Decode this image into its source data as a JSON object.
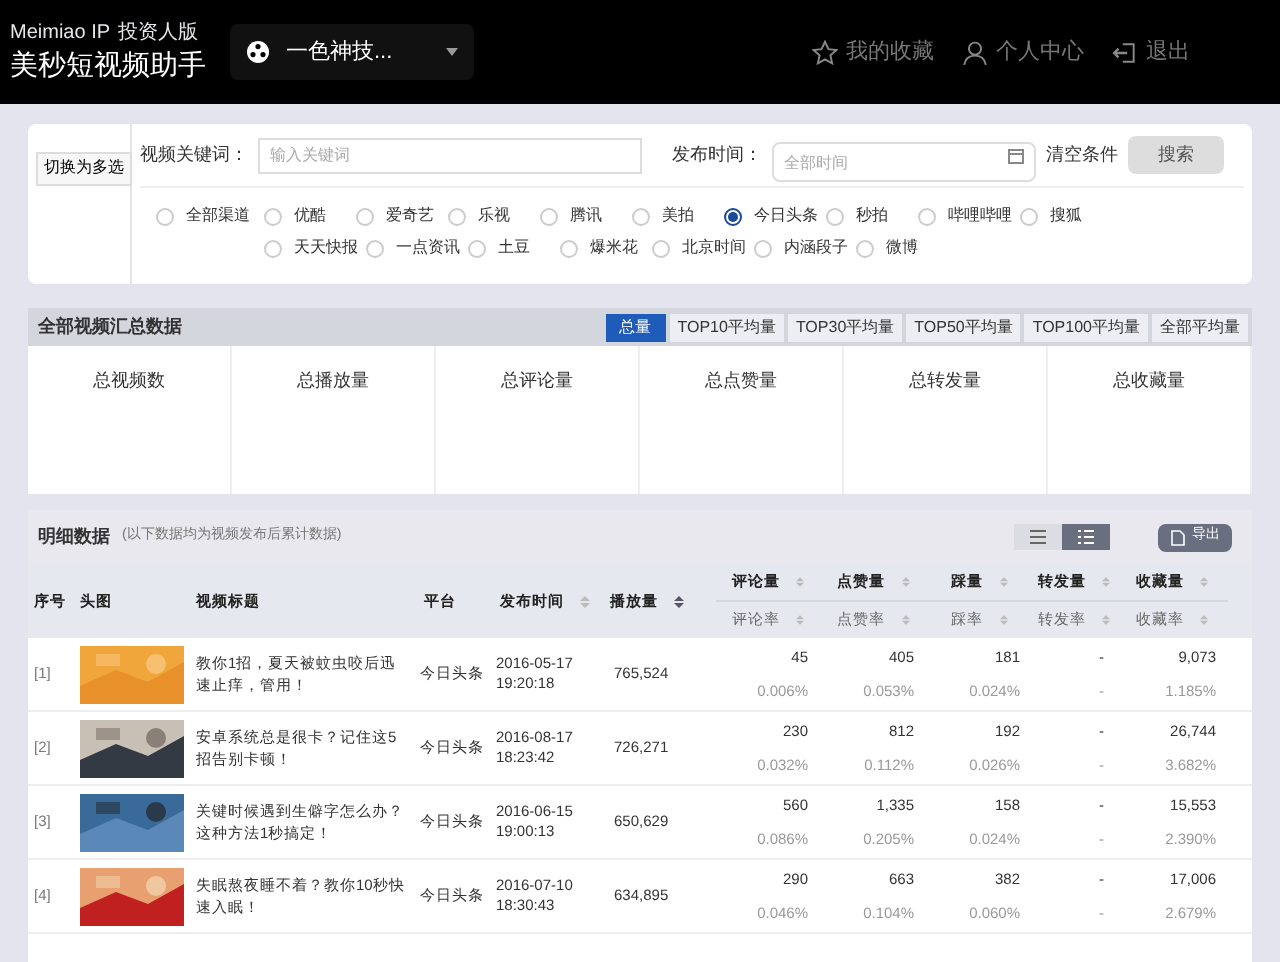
{
  "header": {
    "brand": "Meimiao IP",
    "edition": "投资人版",
    "app_name": "美秒短视频助手",
    "channel_select": "一色神技...",
    "nav": [
      {
        "kind": "favorites",
        "label": "我的收藏"
      },
      {
        "kind": "profile",
        "label": "个人中心"
      },
      {
        "kind": "logout",
        "label": "退出"
      }
    ]
  },
  "filters": {
    "multi_toggle": "切换为多选",
    "keyword_label": "视频关键词：",
    "keyword_placeholder": "输入关键词",
    "date_label": "发布时间：",
    "date_placeholder": "全部时间",
    "clear": "清空条件",
    "search": "搜索",
    "channels": [
      {
        "label": "全部渠道",
        "selected": false
      },
      {
        "label": "优酷",
        "selected": false
      },
      {
        "label": "爱奇艺",
        "selected": false
      },
      {
        "label": "乐视",
        "selected": false
      },
      {
        "label": "腾讯",
        "selected": false
      },
      {
        "label": "美拍",
        "selected": false
      },
      {
        "label": "今日头条",
        "selected": true
      },
      {
        "label": "秒拍",
        "selected": false
      },
      {
        "label": "哔哩哔哩",
        "selected": false
      },
      {
        "label": "搜狐",
        "selected": false
      },
      {
        "label": "天天快报",
        "selected": false
      },
      {
        "label": "一点资讯",
        "selected": false
      },
      {
        "label": "土豆",
        "selected": false
      },
      {
        "label": "爆米花",
        "selected": false
      },
      {
        "label": "北京时间",
        "selected": false
      },
      {
        "label": "内涵段子",
        "selected": false
      },
      {
        "label": "微博",
        "selected": false
      }
    ]
  },
  "summary": {
    "title": "全部视频汇总数据",
    "tabs": [
      {
        "label": "总量",
        "selected": true
      },
      {
        "label": "TOP10平均量",
        "selected": false
      },
      {
        "label": "TOP30平均量",
        "selected": false
      },
      {
        "label": "TOP50平均量",
        "selected": false
      },
      {
        "label": "TOP100平均量",
        "selected": false
      },
      {
        "label": "全部平均量",
        "selected": false
      }
    ],
    "stats": [
      {
        "label": "总视频数"
      },
      {
        "label": "总播放量"
      },
      {
        "label": "总评论量"
      },
      {
        "label": "总点赞量"
      },
      {
        "label": "总转发量"
      },
      {
        "label": "总收藏量"
      }
    ]
  },
  "detail": {
    "title": "明细数据",
    "note": "(以下数据均为视频发布后累计数据)",
    "view_toggle": [
      {
        "kind": "list",
        "selected": false
      },
      {
        "kind": "detail",
        "selected": true
      }
    ],
    "export": "导出",
    "columns": [
      "序号",
      "头图",
      "视频标题",
      "平台",
      "发布时间",
      "播放量"
    ],
    "metric_columns": [
      {
        "count": "评论量",
        "rate": "评论率"
      },
      {
        "count": "点赞量",
        "rate": "点赞率"
      },
      {
        "count": "踩量",
        "rate": "踩率"
      },
      {
        "count": "转发量",
        "rate": "转发率"
      },
      {
        "count": "收藏量",
        "rate": "收藏率"
      }
    ],
    "rows": [
      {
        "index": "[1]",
        "title": "教你1招，夏天被蚊虫咬后迅速止痒，管用！",
        "platform": "今日头条",
        "date": "2016-05-17",
        "time": "19:20:18",
        "plays": "765,524",
        "metrics": [
          {
            "count": "45",
            "rate": "0.006%"
          },
          {
            "count": "405",
            "rate": "0.053%"
          },
          {
            "count": "181",
            "rate": "0.024%"
          },
          {
            "count": "-",
            "rate": "-"
          },
          {
            "count": "9,073",
            "rate": "1.185%"
          }
        ]
      },
      {
        "index": "[2]",
        "title": "安卓系统总是很卡？记住这5招告别卡顿！",
        "platform": "今日头条",
        "date": "2016-08-17",
        "time": "18:23:42",
        "plays": "726,271",
        "metrics": [
          {
            "count": "230",
            "rate": "0.032%"
          },
          {
            "count": "812",
            "rate": "0.112%"
          },
          {
            "count": "192",
            "rate": "0.026%"
          },
          {
            "count": "-",
            "rate": "-"
          },
          {
            "count": "26,744",
            "rate": "3.682%"
          }
        ]
      },
      {
        "index": "[3]",
        "title": "关键时候遇到生僻字怎么办？这种方法1秒搞定！",
        "platform": "今日头条",
        "date": "2016-06-15",
        "time": "19:00:13",
        "plays": "650,629",
        "metrics": [
          {
            "count": "560",
            "rate": "0.086%"
          },
          {
            "count": "1,335",
            "rate": "0.205%"
          },
          {
            "count": "158",
            "rate": "0.024%"
          },
          {
            "count": "-",
            "rate": "-"
          },
          {
            "count": "15,553",
            "rate": "2.390%"
          }
        ]
      },
      {
        "index": "[4]",
        "title": "失眠熬夜睡不着？教你10秒快速入眠！",
        "platform": "今日头条",
        "date": "2016-07-10",
        "time": "18:30:43",
        "plays": "634,895",
        "metrics": [
          {
            "count": "290",
            "rate": "0.046%"
          },
          {
            "count": "663",
            "rate": "0.104%"
          },
          {
            "count": "382",
            "rate": "0.060%"
          },
          {
            "count": "-",
            "rate": "-"
          },
          {
            "count": "17,006",
            "rate": "2.679%"
          }
        ]
      }
    ]
  }
}
